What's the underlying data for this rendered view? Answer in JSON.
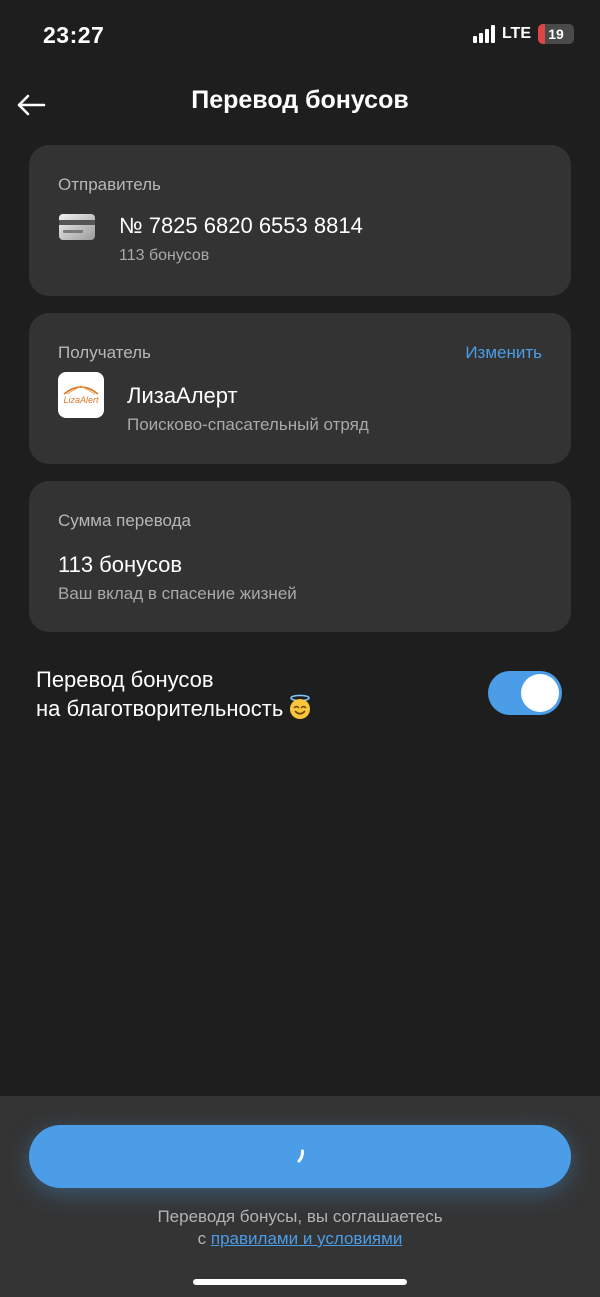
{
  "status_bar": {
    "time": "23:27",
    "network": "LTE",
    "battery_level": "19",
    "battery_color": "#e04545"
  },
  "header": {
    "title": "Перевод бонусов",
    "back_icon": "arrow-left-icon"
  },
  "sender": {
    "label": "Отправитель",
    "card_number": "№ 7825 6820 6553 8814",
    "balance": "113 бонусов",
    "icon": "card-icon"
  },
  "recipient": {
    "label": "Получатель",
    "change_label": "Изменить",
    "name": "ЛизаАлерт",
    "description": "Поисково-спасательный отряд",
    "logo_text": "LizaAlert"
  },
  "amount": {
    "label": "Сумма перевода",
    "value": "113 бонусов",
    "description": "Ваш вклад в спасение жизней"
  },
  "charity_toggle": {
    "line1": "Перевод бонусов",
    "line2": "на благотворительность",
    "emoji": "smiling-face-with-halo-icon",
    "enabled": true
  },
  "footer": {
    "button_state": "loading",
    "terms_text": "Переводя бонусы, вы соглашаетесь",
    "terms_prefix": "с",
    "terms_link": "правилами и условиями"
  },
  "colors": {
    "background": "#1e1e1e",
    "card": "#333333",
    "accent": "#4b9de8",
    "secondary_text": "#a9a9a9"
  }
}
